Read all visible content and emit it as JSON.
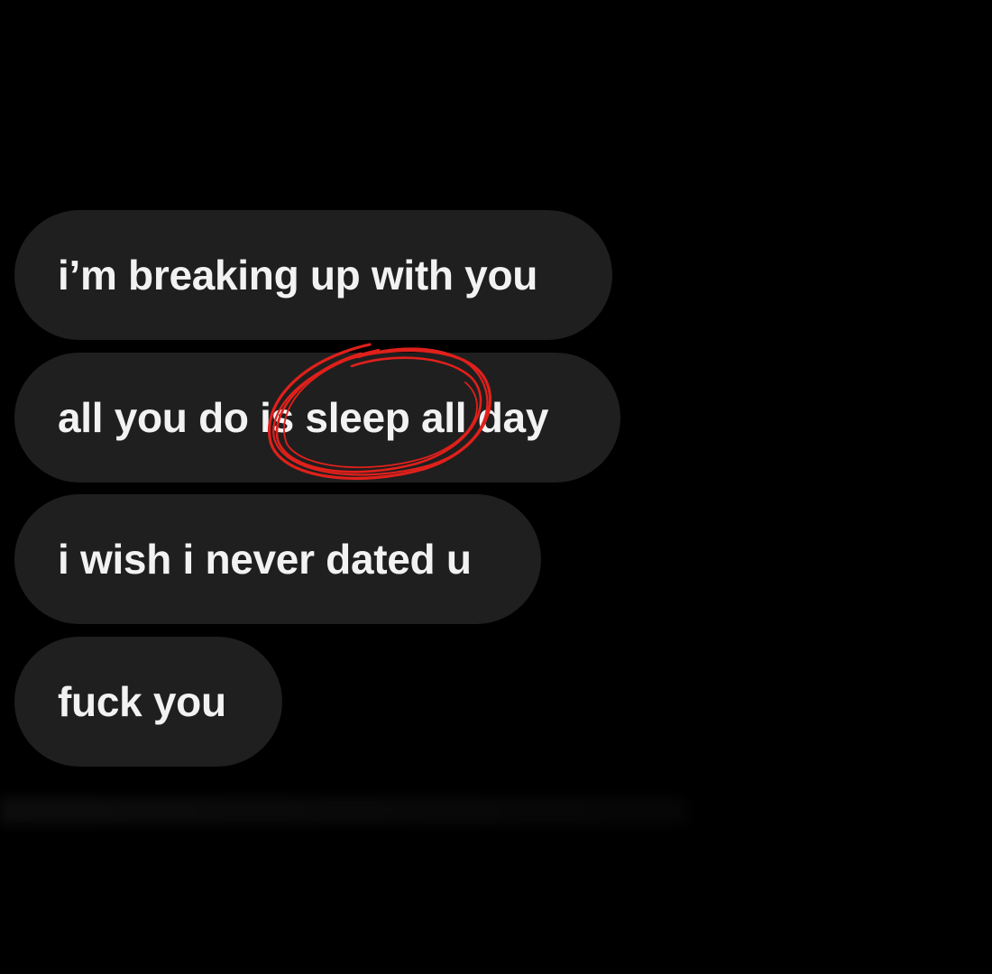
{
  "messages": [
    {
      "text": "i’m breaking up with you"
    },
    {
      "text": "all you do is sleep all day"
    },
    {
      "text": "i wish i never dated u"
    },
    {
      "text": "fuck you"
    }
  ],
  "annotation": {
    "type": "red-circle-scribble",
    "color": "#e0201b",
    "target_text": "is sleep all"
  },
  "colors": {
    "background": "#000000",
    "bubble": "#1f1f1f",
    "text": "#f2f2f2"
  }
}
